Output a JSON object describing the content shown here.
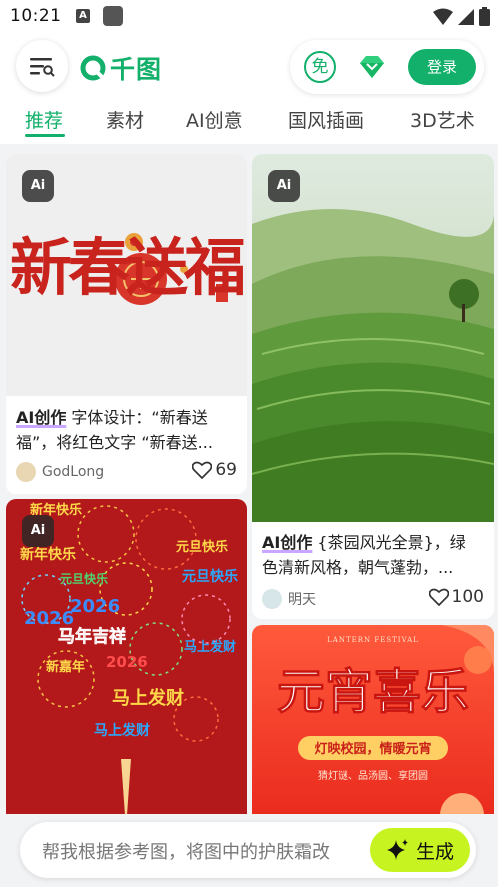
{
  "status_bar": {
    "time": "10:21",
    "badge_letter": "A"
  },
  "header": {
    "logo_text": "千图",
    "free_label": "免",
    "login_label": "登录"
  },
  "tabs": [
    {
      "label": "推荐",
      "active": true
    },
    {
      "label": "素材",
      "active": false
    },
    {
      "label": "AI创意",
      "active": false
    },
    {
      "label": "国风插画",
      "active": false
    },
    {
      "label": "3D艺术",
      "active": false
    }
  ],
  "cards": [
    {
      "badge": "Ai",
      "image_text": "新春送福",
      "tag": "AI创作",
      "line1": " 字体设计：“新春送",
      "line2": "福”，将红色文字 “新春送...",
      "user": "GodLong",
      "likes": "69"
    },
    {
      "badge": "Ai",
      "tag": "AI创作",
      "line1": " {茶园风光全景}，绿",
      "line2": "色清新风格，朝气蓬勃，...",
      "user": "明天",
      "likes": "100"
    },
    {
      "badge": "Ai",
      "image_texts": [
        "新年快乐",
        "元旦快乐",
        "新年快乐",
        "元旦快乐",
        "元旦快乐",
        "2026",
        "2026",
        "马年吉祥",
        "新嘉年",
        "2026",
        "马上发财",
        "马上发财",
        "马上发财"
      ]
    },
    {
      "image_small": "LANTERN FESTIVAL",
      "image_title": "元宵喜乐",
      "image_banner": "灯映校园，情暖元宵",
      "image_sub": "猜灯谜、品汤圆、享团圆"
    }
  ],
  "prompt": {
    "placeholder": "帮我根据参考图，将图中的护肤霜改",
    "generate_label": "生成"
  },
  "colors": {
    "accent": "#12b06a",
    "generate": "#c7f321"
  }
}
